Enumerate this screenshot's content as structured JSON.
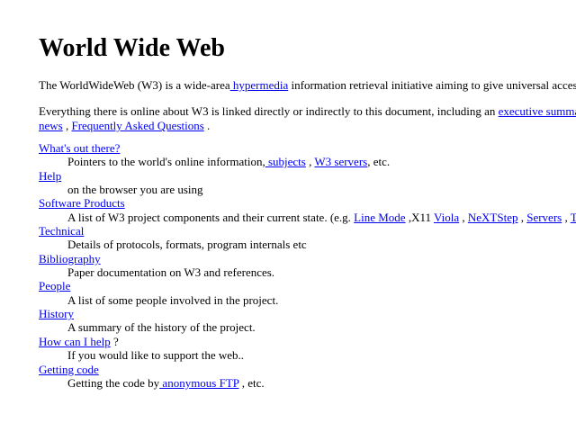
{
  "title": "World Wide Web",
  "intro": {
    "before": "The WorldWideWeb (W3) is a wide-area",
    "link": " hypermedia",
    "after": " information retrieval initiative aiming to give universal access"
  },
  "overview": {
    "line1_before": "Everything there is online about W3 is linked directly or indirectly to this document, including an ",
    "link_summary": "executive summar",
    "link_news": "news",
    "sep1": " , ",
    "link_faq": "Frequently Asked Questions",
    "end": " ."
  },
  "topics": [
    {
      "label": "What's out there?",
      "desc_before": "Pointers to the world's online information,",
      "link_subjects": " subjects",
      "sep": " , ",
      "link_w3servers": "W3 servers",
      "desc_after": ", etc."
    },
    {
      "label": "Help",
      "desc": "on the browser you are using"
    },
    {
      "label": "Software Products",
      "desc_before": "A list of W3 project components and their current state. (e.g. ",
      "link_linemode": "Line Mode",
      "text_x11": " ,X11 ",
      "link_viola": "Viola",
      "sep_a": " , ",
      "link_nextstep": "NeXTStep",
      "sep_b": " , ",
      "link_servers": "Servers",
      "sep_c": " , ",
      "link_tools": "To"
    },
    {
      "label": "Technical",
      "desc": "Details of protocols, formats, program internals etc"
    },
    {
      "label": "Bibliography",
      "desc": "Paper documentation on W3 and references."
    },
    {
      "label": "People",
      "desc": "A list of some people involved in the project."
    },
    {
      "label": "History",
      "desc": "A summary of the history of the project."
    },
    {
      "label": "How can I help",
      "label_suffix": " ?",
      "desc": "If you would like to support the web.."
    },
    {
      "label": "Getting code",
      "desc_before": "Getting the code by",
      "link_ftp": " anonymous FTP",
      "desc_after": " , etc."
    }
  ]
}
